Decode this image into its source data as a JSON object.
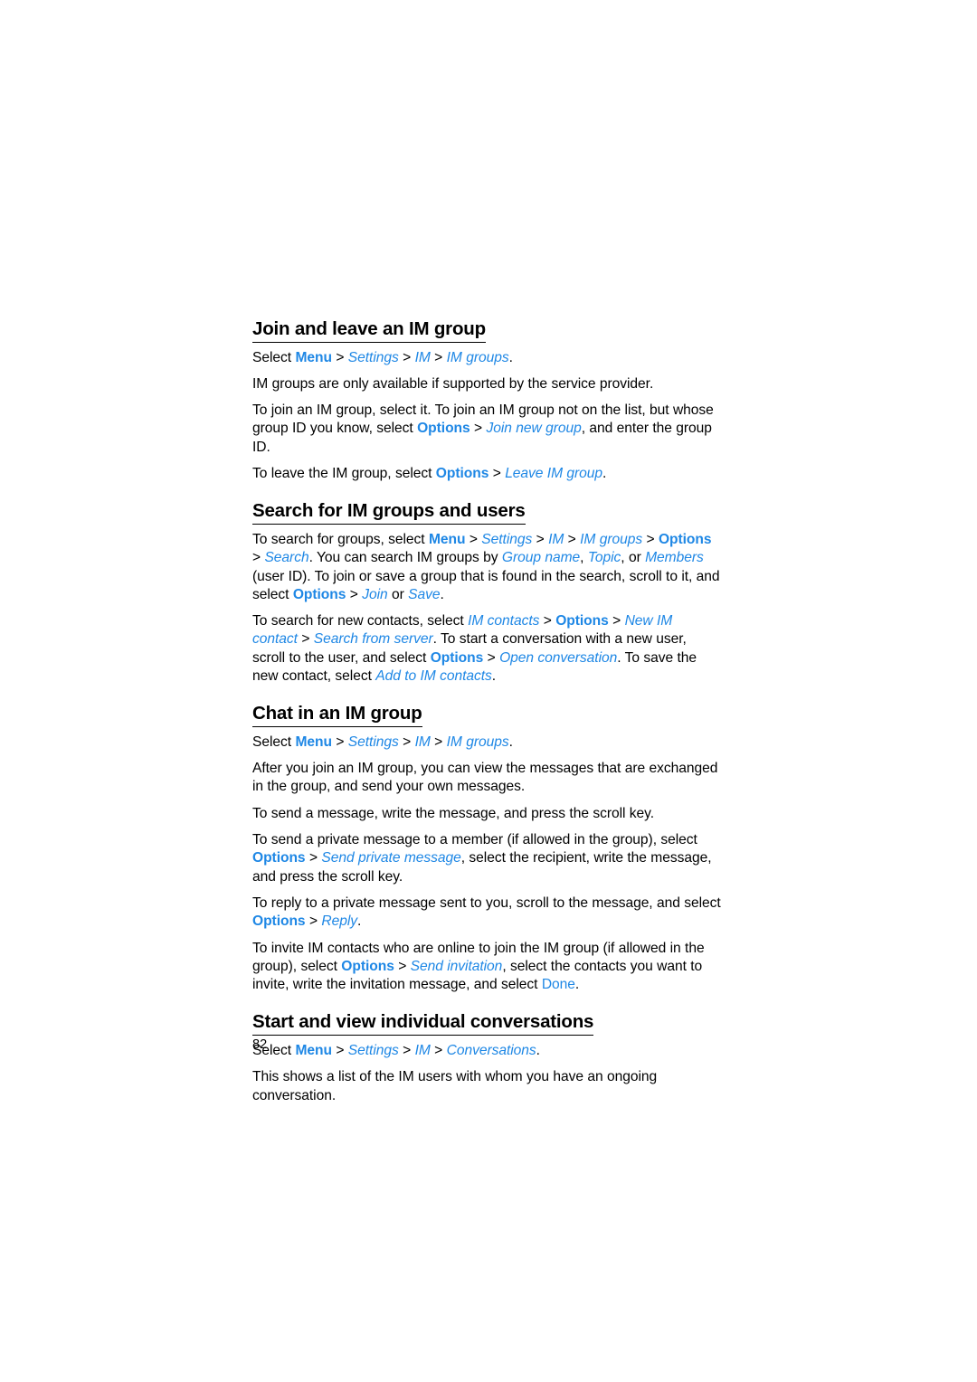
{
  "document": {
    "page_number": "82",
    "accent_color": "#1E87E5",
    "text_color": "#000000",
    "background_color": "#ffffff"
  },
  "sections": [
    {
      "heading": "Join and leave an IM group",
      "paragraphs": [
        {
          "id": "p1",
          "runs": [
            {
              "t": "Select ",
              "s": "plain"
            },
            {
              "t": "Menu",
              "s": "key"
            },
            {
              "t": " > ",
              "s": "sep"
            },
            {
              "t": "Settings",
              "s": "item"
            },
            {
              "t": " > ",
              "s": "sep"
            },
            {
              "t": "IM",
              "s": "item"
            },
            {
              "t": " > ",
              "s": "sep"
            },
            {
              "t": "IM groups",
              "s": "item"
            },
            {
              "t": ".",
              "s": "plain"
            }
          ]
        },
        {
          "id": "p2",
          "runs": [
            {
              "t": "IM groups are only available if supported by the service provider.",
              "s": "plain"
            }
          ]
        },
        {
          "id": "p3",
          "runs": [
            {
              "t": "To join an IM group, select it. To join an IM group not on the list, but whose group ID you know, select ",
              "s": "plain"
            },
            {
              "t": "Options",
              "s": "key"
            },
            {
              "t": " > ",
              "s": "sep"
            },
            {
              "t": "Join new group",
              "s": "item"
            },
            {
              "t": ", and enter the group ID.",
              "s": "plain"
            }
          ]
        },
        {
          "id": "p4",
          "runs": [
            {
              "t": "To leave the IM group, select ",
              "s": "plain"
            },
            {
              "t": "Options",
              "s": "key"
            },
            {
              "t": " > ",
              "s": "sep"
            },
            {
              "t": "Leave IM group",
              "s": "item"
            },
            {
              "t": ".",
              "s": "plain"
            }
          ]
        }
      ]
    },
    {
      "heading": "Search for IM groups and users",
      "paragraphs": [
        {
          "id": "p5",
          "runs": [
            {
              "t": "To search for groups, select ",
              "s": "plain"
            },
            {
              "t": "Menu",
              "s": "key"
            },
            {
              "t": " > ",
              "s": "sep"
            },
            {
              "t": "Settings",
              "s": "item"
            },
            {
              "t": " > ",
              "s": "sep"
            },
            {
              "t": "IM",
              "s": "item"
            },
            {
              "t": " > ",
              "s": "sep"
            },
            {
              "t": "IM groups",
              "s": "item"
            },
            {
              "t": " > ",
              "s": "sep"
            },
            {
              "t": "Options",
              "s": "key"
            },
            {
              "t": " > ",
              "s": "sep"
            },
            {
              "t": "Search",
              "s": "item"
            },
            {
              "t": ". You can search IM groups by ",
              "s": "plain"
            },
            {
              "t": "Group name",
              "s": "item"
            },
            {
              "t": ", ",
              "s": "plain"
            },
            {
              "t": "Topic",
              "s": "item"
            },
            {
              "t": ", or ",
              "s": "plain"
            },
            {
              "t": "Members",
              "s": "item"
            },
            {
              "t": " (user ID). To join or save a group that is found in the search, scroll to it, and select ",
              "s": "plain"
            },
            {
              "t": "Options",
              "s": "key"
            },
            {
              "t": " > ",
              "s": "sep"
            },
            {
              "t": "Join",
              "s": "item"
            },
            {
              "t": " or ",
              "s": "plain"
            },
            {
              "t": "Save",
              "s": "item"
            },
            {
              "t": ".",
              "s": "plain"
            }
          ]
        },
        {
          "id": "p6",
          "runs": [
            {
              "t": "To search for new contacts, select ",
              "s": "plain"
            },
            {
              "t": "IM contacts",
              "s": "item"
            },
            {
              "t": " > ",
              "s": "sep"
            },
            {
              "t": "Options",
              "s": "key"
            },
            {
              "t": " > ",
              "s": "sep"
            },
            {
              "t": "New IM contact",
              "s": "item"
            },
            {
              "t": " > ",
              "s": "sep"
            },
            {
              "t": "Search from server",
              "s": "item"
            },
            {
              "t": ". To start a conversation with a new user, scroll to the user, and select ",
              "s": "plain"
            },
            {
              "t": "Options",
              "s": "key"
            },
            {
              "t": " > ",
              "s": "sep"
            },
            {
              "t": "Open conversation",
              "s": "item"
            },
            {
              "t": ". To save the new contact, select ",
              "s": "plain"
            },
            {
              "t": "Add to IM contacts",
              "s": "item"
            },
            {
              "t": ".",
              "s": "plain"
            }
          ]
        }
      ]
    },
    {
      "heading": "Chat in an IM group",
      "paragraphs": [
        {
          "id": "p7",
          "runs": [
            {
              "t": "Select ",
              "s": "plain"
            },
            {
              "t": "Menu",
              "s": "key"
            },
            {
              "t": " > ",
              "s": "sep"
            },
            {
              "t": "Settings",
              "s": "item"
            },
            {
              "t": " > ",
              "s": "sep"
            },
            {
              "t": "IM",
              "s": "item"
            },
            {
              "t": " > ",
              "s": "sep"
            },
            {
              "t": "IM groups",
              "s": "item"
            },
            {
              "t": ".",
              "s": "plain"
            }
          ]
        },
        {
          "id": "p8",
          "runs": [
            {
              "t": "After you join an IM group, you can view the messages that are exchanged in the group, and send your own messages.",
              "s": "plain"
            }
          ]
        },
        {
          "id": "p9",
          "runs": [
            {
              "t": "To send a message, write the message, and press the scroll key.",
              "s": "plain"
            }
          ]
        },
        {
          "id": "p10",
          "runs": [
            {
              "t": "To send a private message to a member (if allowed in the group), select ",
              "s": "plain"
            },
            {
              "t": "Options",
              "s": "key"
            },
            {
              "t": " > ",
              "s": "sep"
            },
            {
              "t": "Send private message",
              "s": "item"
            },
            {
              "t": ", select the recipient, write the message, and press the scroll key.",
              "s": "plain"
            }
          ]
        },
        {
          "id": "p11",
          "runs": [
            {
              "t": "To reply to a private message sent to you, scroll to the message, and select ",
              "s": "plain"
            },
            {
              "t": "Options",
              "s": "key"
            },
            {
              "t": " > ",
              "s": "sep"
            },
            {
              "t": "Reply",
              "s": "item"
            },
            {
              "t": ".",
              "s": "plain"
            }
          ]
        },
        {
          "id": "p12",
          "runs": [
            {
              "t": "To invite IM contacts who are online to join the IM group (if allowed in the group), select ",
              "s": "plain"
            },
            {
              "t": "Options",
              "s": "key"
            },
            {
              "t": " > ",
              "s": "sep"
            },
            {
              "t": "Send invitation",
              "s": "item"
            },
            {
              "t": ", select the contacts you want to invite, write the invitation message, and select ",
              "s": "plain"
            },
            {
              "t": "Done",
              "s": "soft"
            },
            {
              "t": ".",
              "s": "plain"
            }
          ]
        }
      ]
    },
    {
      "heading": "Start and view individual conversations",
      "paragraphs": [
        {
          "id": "p13",
          "runs": [
            {
              "t": "Select ",
              "s": "plain"
            },
            {
              "t": "Menu",
              "s": "key"
            },
            {
              "t": " > ",
              "s": "sep"
            },
            {
              "t": "Settings",
              "s": "item"
            },
            {
              "t": " > ",
              "s": "sep"
            },
            {
              "t": "IM",
              "s": "item"
            },
            {
              "t": " > ",
              "s": "sep"
            },
            {
              "t": "Conversations",
              "s": "item"
            },
            {
              "t": ".",
              "s": "plain"
            }
          ]
        },
        {
          "id": "p14",
          "runs": [
            {
              "t": "This shows a list of the IM users with whom you have an ongoing conversation.",
              "s": "plain"
            }
          ]
        }
      ]
    }
  ]
}
